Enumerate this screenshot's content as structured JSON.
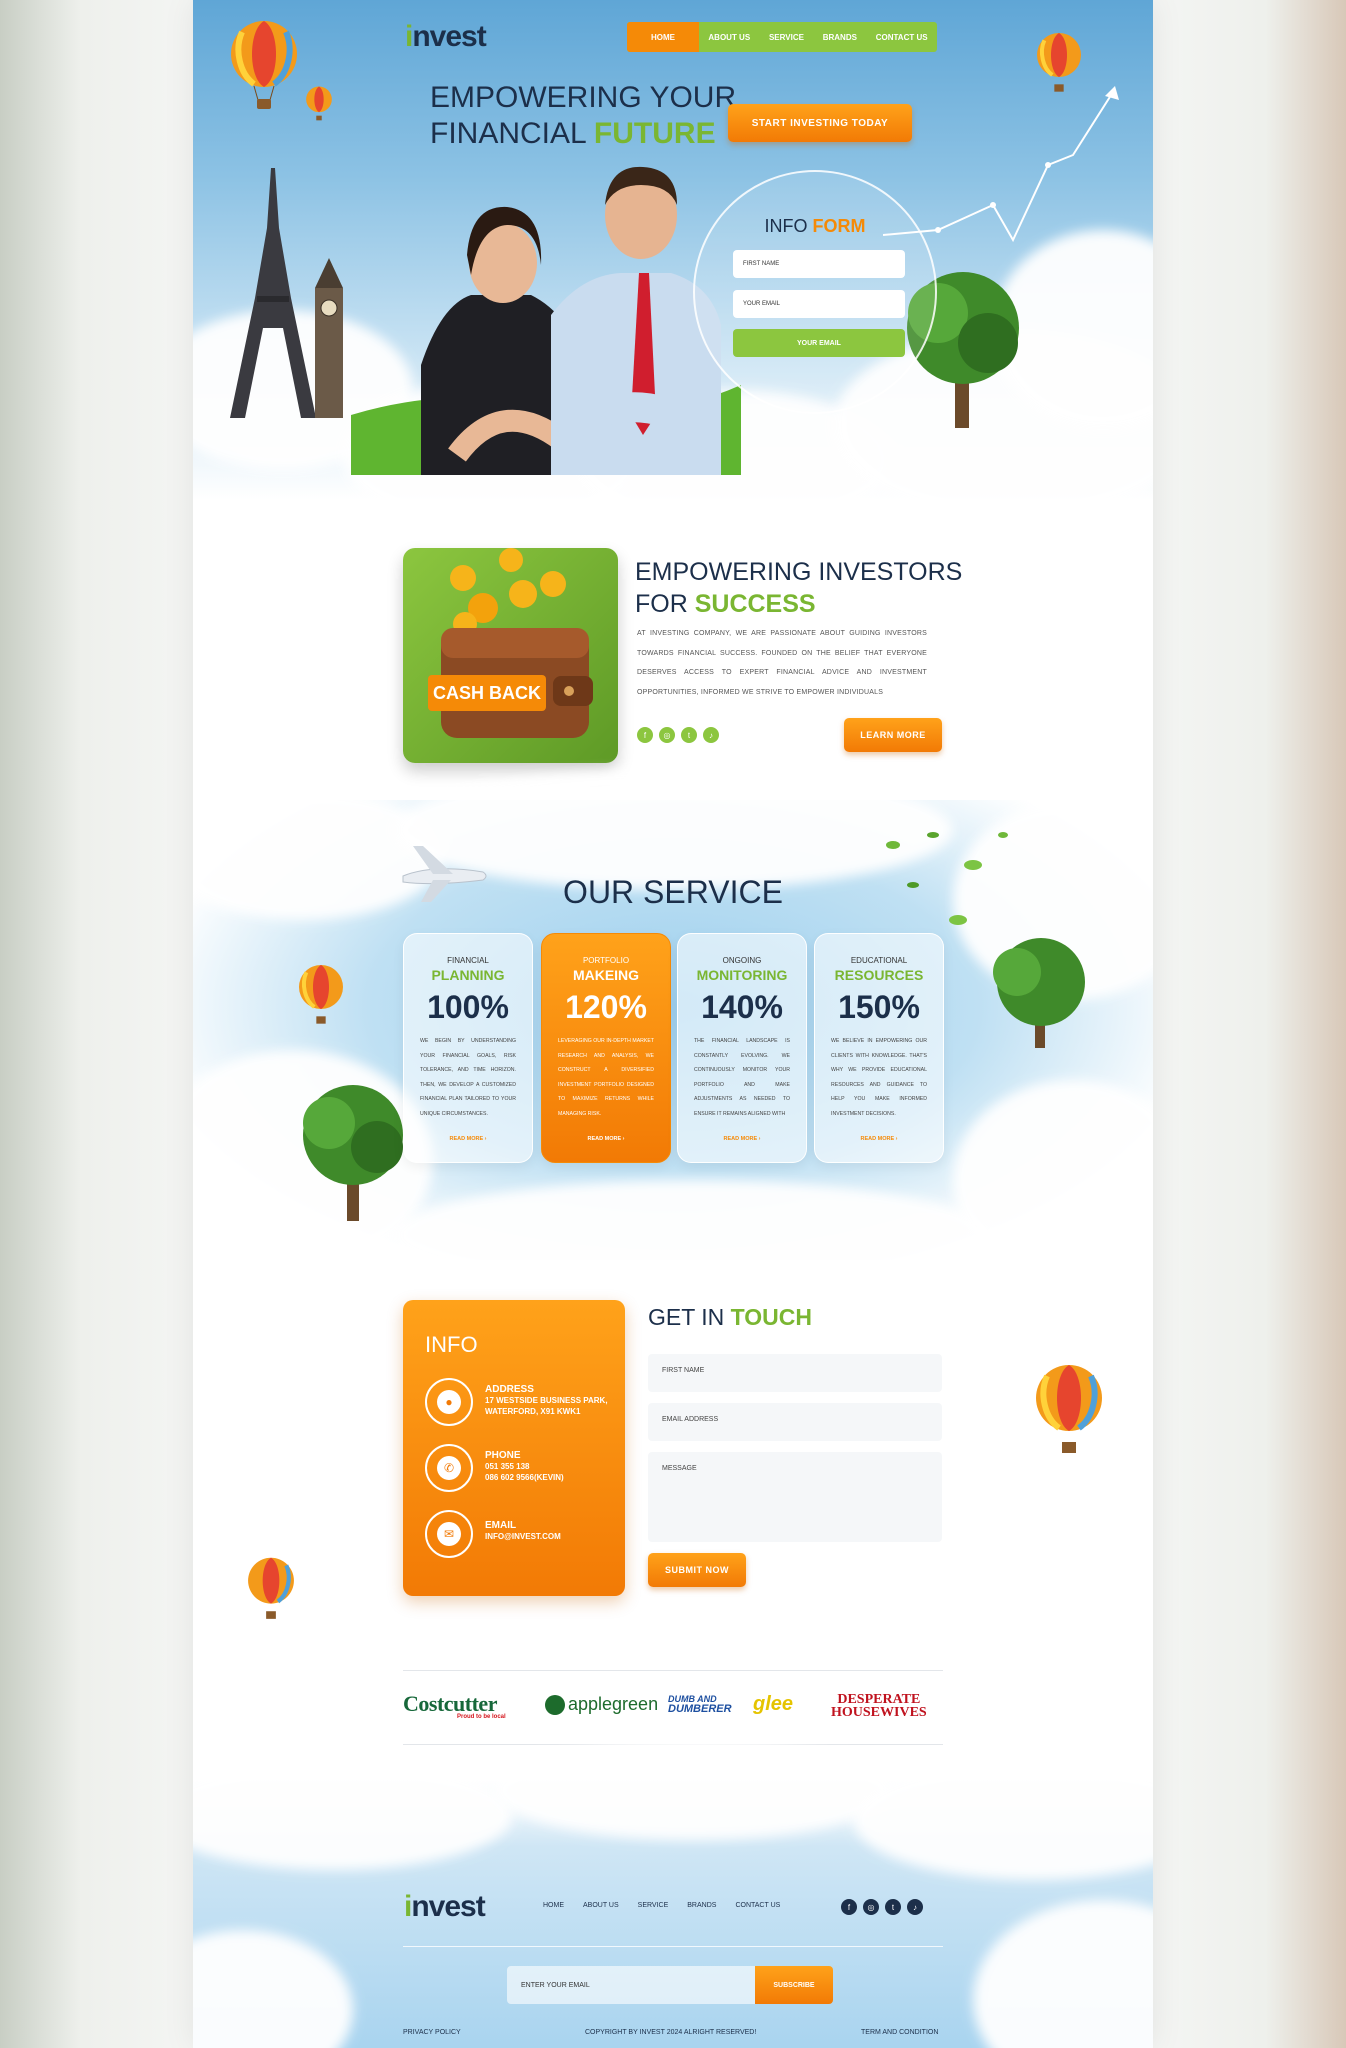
{
  "brand": {
    "logo_i": "i",
    "logo_rest": "nvest"
  },
  "nav": {
    "items": [
      "HOME",
      "ABOUT US",
      "SERVICE",
      "BRANDS",
      "CONTACT US"
    ]
  },
  "hero": {
    "title_line1": "EMPOWERING YOUR",
    "title_line2_plain": "FINANCIAL ",
    "title_line2_highlight": "FUTURE",
    "cta": "START INVESTING TODAY",
    "form": {
      "title_plain": "INFO ",
      "title_highlight": "FORM",
      "first_name": "FIRST NAME",
      "email": "YOUR EMAIL",
      "button": "YOUR EMAIL"
    }
  },
  "about": {
    "image_label": "CASH BACK",
    "title_line1": "EMPOWERING INVESTORS",
    "title_line2_plain": "FOR ",
    "title_line2_highlight": "SUCCESS",
    "text": "AT INVESTING COMPANY, WE ARE PASSIONATE ABOUT GUIDING INVESTORS TOWARDS FINANCIAL SUCCESS. FOUNDED ON THE BELIEF THAT EVERYONE DESERVES ACCESS TO EXPERT FINANCIAL ADVICE AND INVESTMENT OPPORTUNITIES, INFORMED WE STRIVE TO EMPOWER INDIVIDUALS",
    "button": "LEARN MORE",
    "social_icons": [
      "facebook-icon",
      "instagram-icon",
      "twitter-icon",
      "tiktok-icon"
    ]
  },
  "services": {
    "title": "OUR SERVICE",
    "cards": [
      {
        "category": "FINANCIAL",
        "name": "PLANNING",
        "percent": "100%",
        "text": "WE BEGIN BY UNDERSTANDING YOUR FINANCIAL GOALS, RISK TOLERANCE, AND TIME HORIZON. THEN, WE DEVELOP A CUSTOMIZED FINANCIAL PLAN TAILORED TO YOUR UNIQUE CIRCUMSTANCES.",
        "more": "READ MORE ›"
      },
      {
        "category": "PORTFOLIO",
        "name": "MAKEING",
        "percent": "120%",
        "text": "LEVERAGING OUR IN-DEPTH MARKET RESEARCH AND ANALYSIS, WE CONSTRUCT A DIVERSIFIED INVESTMENT PORTFOLIO DESIGNED TO MAXIMIZE RETURNS WHILE MANAGING RISK.",
        "more": "READ MORE ›"
      },
      {
        "category": "ONGOING",
        "name": "MONITORING",
        "percent": "140%",
        "text": "THE FINANCIAL LANDSCAPE IS CONSTANTLY EVOLVING. WE CONTINUOUSLY MONITOR YOUR PORTFOLIO AND MAKE ADJUSTMENTS AS NEEDED TO ENSURE IT REMAINS ALIGNED WITH",
        "more": "READ MORE ›"
      },
      {
        "category": "EDUCATIONAL",
        "name": "RESOURCES",
        "percent": "150%",
        "text": "WE BELIEVE IN EMPOWERING OUR CLIENTS WITH KNOWLEDGE. THAT'S WHY WE PROVIDE EDUCATIONAL RESOURCES AND GUIDANCE TO HELP YOU MAKE INFORMED INVESTMENT DECISIONS.",
        "more": "READ MORE ›"
      }
    ]
  },
  "contact": {
    "info_title": "INFO",
    "address_label": "ADDRESS",
    "address_line1": "17 WESTSIDE BUSINESS PARK,",
    "address_line2": "WATERFORD, X91 KWK1",
    "phone_label": "PHONE",
    "phone_line1": "051 355 138",
    "phone_line2": "086 602 9566(KEVIN)",
    "email_label": "EMAIL",
    "email_value": "INFO@INVEST.COM",
    "touch_plain": "GET IN ",
    "touch_highlight": "TOUCH",
    "field_first_name": "FIRST NAME",
    "field_email": "EMAIL ADDRESS",
    "field_message": "MESSAGE",
    "submit": "SUBMIT NOW"
  },
  "brands": {
    "costcutter": "Costcutter",
    "costcutter_tag": "Proud to be local",
    "applegreen": "applegreen",
    "dumb_line1": "DUMB AND",
    "dumb_line2": "DUMBERER",
    "glee": "glee",
    "desperate_line1": "DESPERATE",
    "desperate_line2": "HOUSEWIVES"
  },
  "footer": {
    "nav": [
      "HOME",
      "ABOUT US",
      "SERVICE",
      "BRANDS",
      "CONTACT US"
    ],
    "email_placeholder": "ENTER YOUR EMAIL",
    "subscribe": "SUBSCRIBE",
    "privacy": "PRIVACY POLICY",
    "copyright": "COPYRIGHT BY INVEST 2024 ALRIGHT RESERVED!",
    "terms": "TERM AND CONDITION"
  },
  "colors": {
    "accent_orange": "#f58a07",
    "accent_green": "#8cc63f",
    "navy": "#1c2f4a"
  }
}
